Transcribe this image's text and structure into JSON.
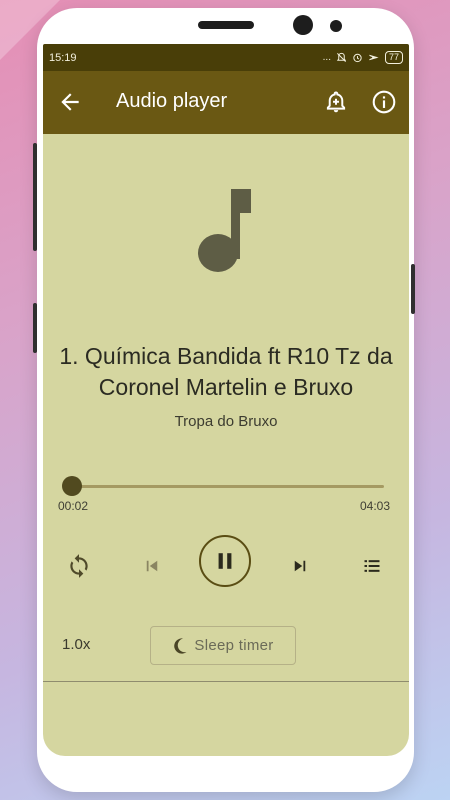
{
  "status_bar": {
    "time": "15:19",
    "indicators": "...",
    "battery": "77",
    "icons": [
      "mute-icon",
      "alarm-icon",
      "airplane-icon",
      "battery-icon"
    ]
  },
  "appbar": {
    "title": "Audio player",
    "icons": [
      "back-arrow-icon",
      "add-alarm-bell-icon",
      "info-icon"
    ]
  },
  "now_playing": {
    "artwork_icon": "music-note-icon",
    "title": "1. Química Bandida ft R10 Tz da Coronel Martelin e Bruxo",
    "artist": "Tropa do Bruxo"
  },
  "seek": {
    "current": "00:02",
    "total": "04:03",
    "progress_fraction": 0.008
  },
  "controls": {
    "icons": [
      "repeat-icon",
      "previous-icon",
      "pause-icon",
      "next-icon",
      "playlist-icon"
    ]
  },
  "bottom": {
    "speed": "1.0x",
    "sleep_label": "Sleep timer",
    "sleep_icon": "moon-icon"
  },
  "colors": {
    "screen_bg": "#d5d6a0",
    "appbar": "#6a5813",
    "status_bar": "#493e08",
    "accent_dark": "#514a1f"
  }
}
